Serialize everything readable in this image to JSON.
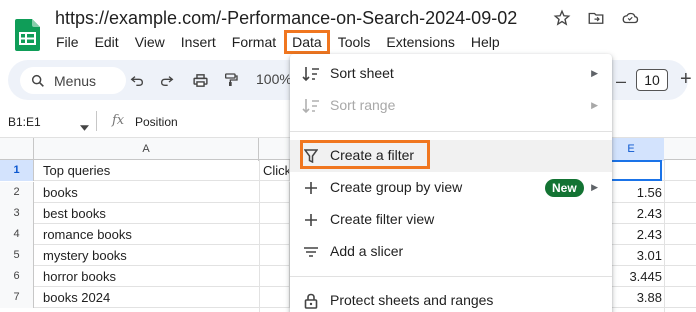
{
  "title": "https://example.com/-Performance-on-Search-2024-09-02",
  "menu": [
    "File",
    "Edit",
    "View",
    "Insert",
    "Format",
    "Data",
    "Tools",
    "Extensions",
    "Help"
  ],
  "toolbar": {
    "search_label": "Menus",
    "zoom": "100%",
    "font_size": "10",
    "minus": "–",
    "plus": "+"
  },
  "formula_bar": {
    "range": "B1:E1",
    "fx": "fx",
    "content": "Position"
  },
  "grid": {
    "col_a_header": "A",
    "col_e_header": "E",
    "rows": [
      {
        "num": "1",
        "a": "Top queries",
        "b": "Click",
        "e": ""
      },
      {
        "num": "2",
        "a": "books",
        "b": "",
        "e": "1.56"
      },
      {
        "num": "3",
        "a": "best books",
        "b": "",
        "e": "2.43"
      },
      {
        "num": "4",
        "a": "romance books",
        "b": "",
        "e": "2.43"
      },
      {
        "num": "5",
        "a": "mystery books",
        "b": "",
        "e": "3.01"
      },
      {
        "num": "6",
        "a": "horror books",
        "b": "",
        "e": "3.445"
      },
      {
        "num": "7",
        "a": "books 2024",
        "b": "",
        "e": "3.88"
      }
    ]
  },
  "data_menu": {
    "sort_sheet": "Sort sheet",
    "sort_range": "Sort range",
    "create_filter": "Create a filter",
    "create_group_view": "Create group by view",
    "new_badge": "New",
    "create_filter_view": "Create filter view",
    "add_slicer": "Add a slicer",
    "protect": "Protect sheets and ranges"
  },
  "colors": {
    "accent": "#f0761f",
    "selection": "#1a73e8",
    "new_badge": "#137333",
    "sheets_green": "#0f9d58"
  }
}
